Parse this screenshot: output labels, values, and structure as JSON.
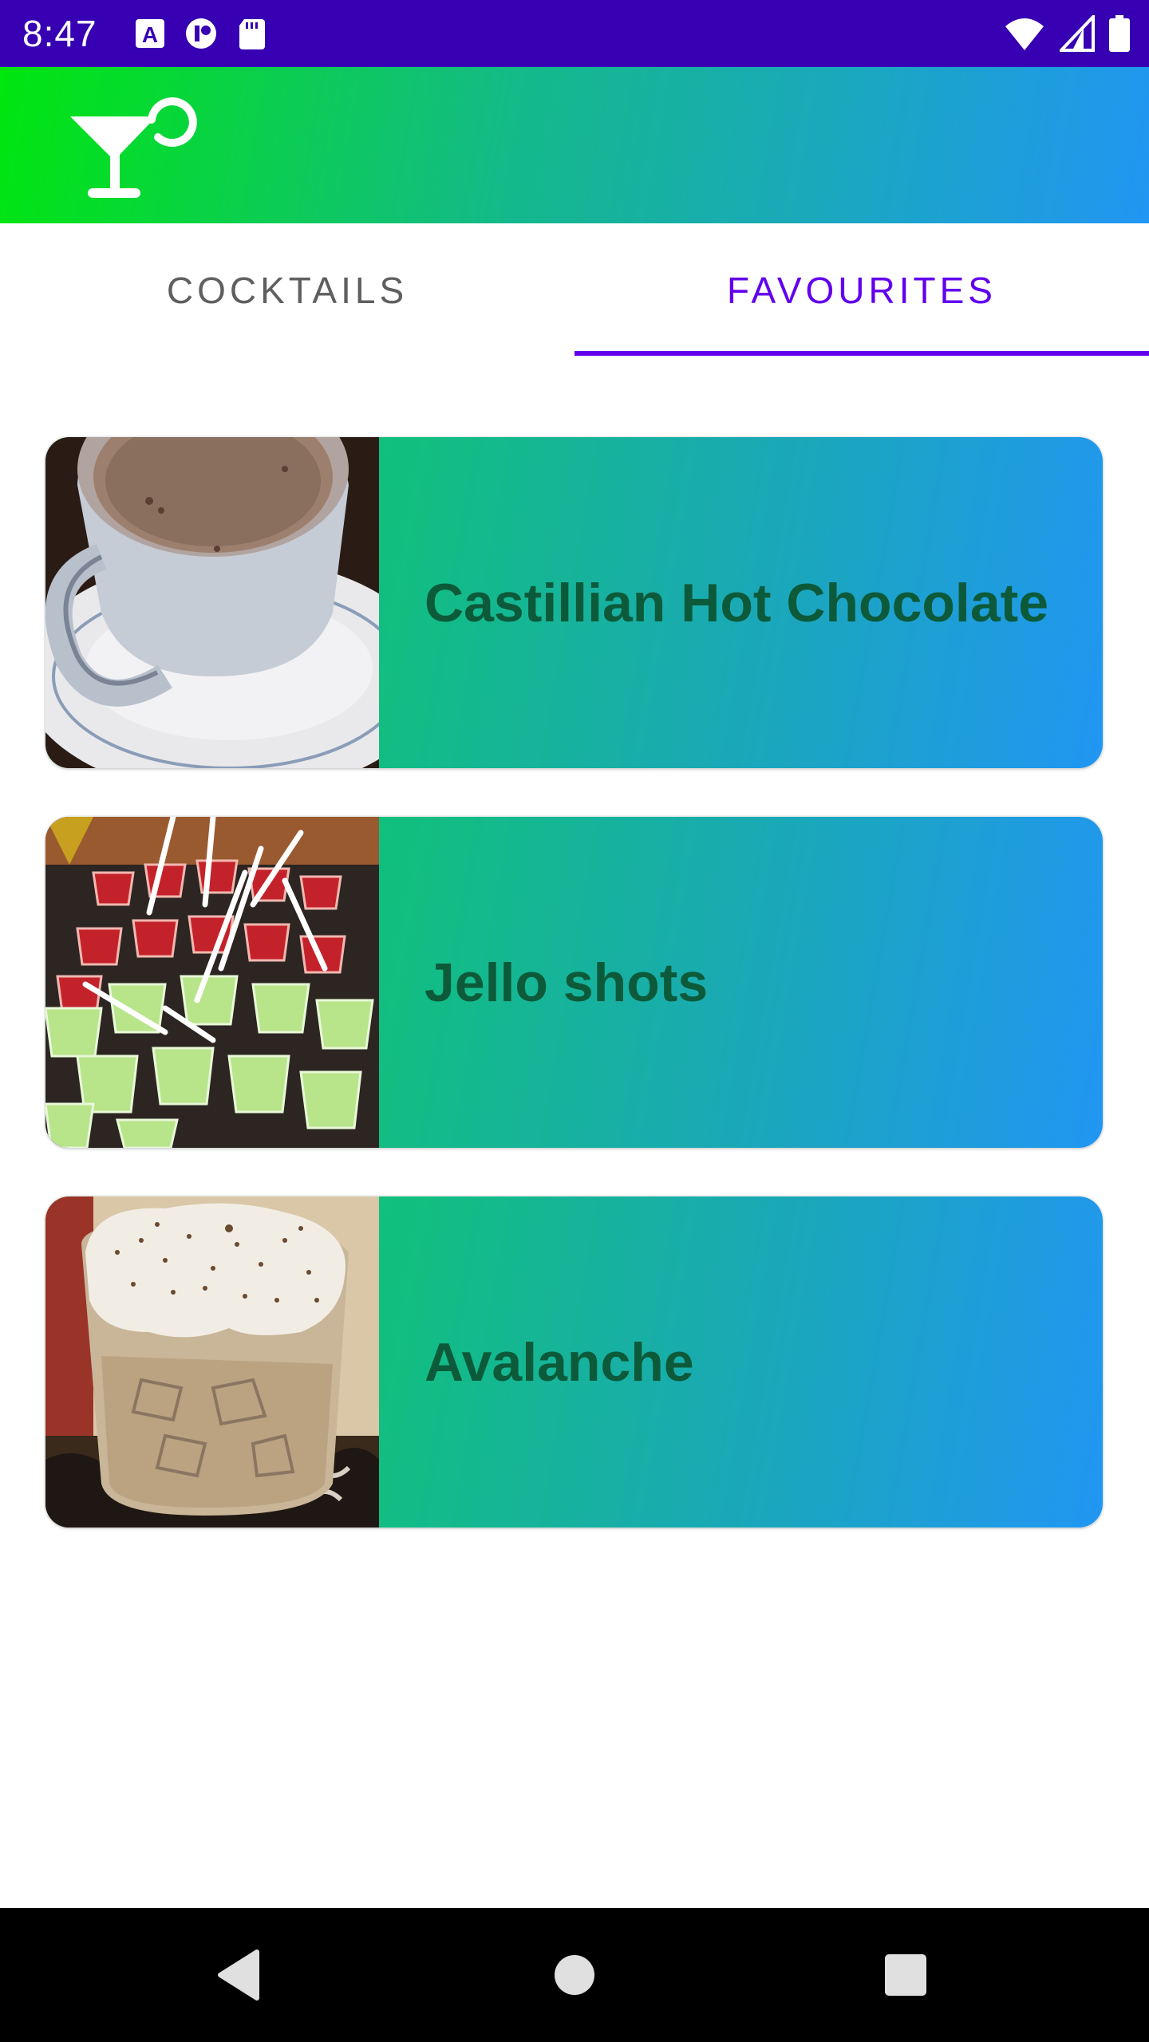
{
  "status_bar": {
    "time": "8:47",
    "icons_left": [
      "a-text-icon",
      "pause-badge-icon",
      "sd-card-icon"
    ],
    "icons_right": [
      "wifi-icon",
      "cell-signal-icon",
      "battery-icon"
    ],
    "background": "#3700b3"
  },
  "app_bar": {
    "logo_icon": "cocktail-glass-icon",
    "gradient": [
      "#00e60e",
      "#2196f3"
    ]
  },
  "tabs": [
    {
      "label": "COCKTAILS",
      "selected": false
    },
    {
      "label": "FAVOURITES",
      "selected": true
    }
  ],
  "accent_color": "#6200ee",
  "favourites": [
    {
      "name": "Castillian Hot Chocolate",
      "image": "hot-chocolate-photo"
    },
    {
      "name": "Jello shots",
      "image": "jello-shots-photo"
    },
    {
      "name": "Avalanche",
      "image": "avalanche-photo"
    }
  ],
  "card_gradient": [
    "#00d05a",
    "#2196f3"
  ],
  "nav_bar": {
    "buttons": [
      "back-icon",
      "home-icon",
      "recents-icon"
    ]
  }
}
